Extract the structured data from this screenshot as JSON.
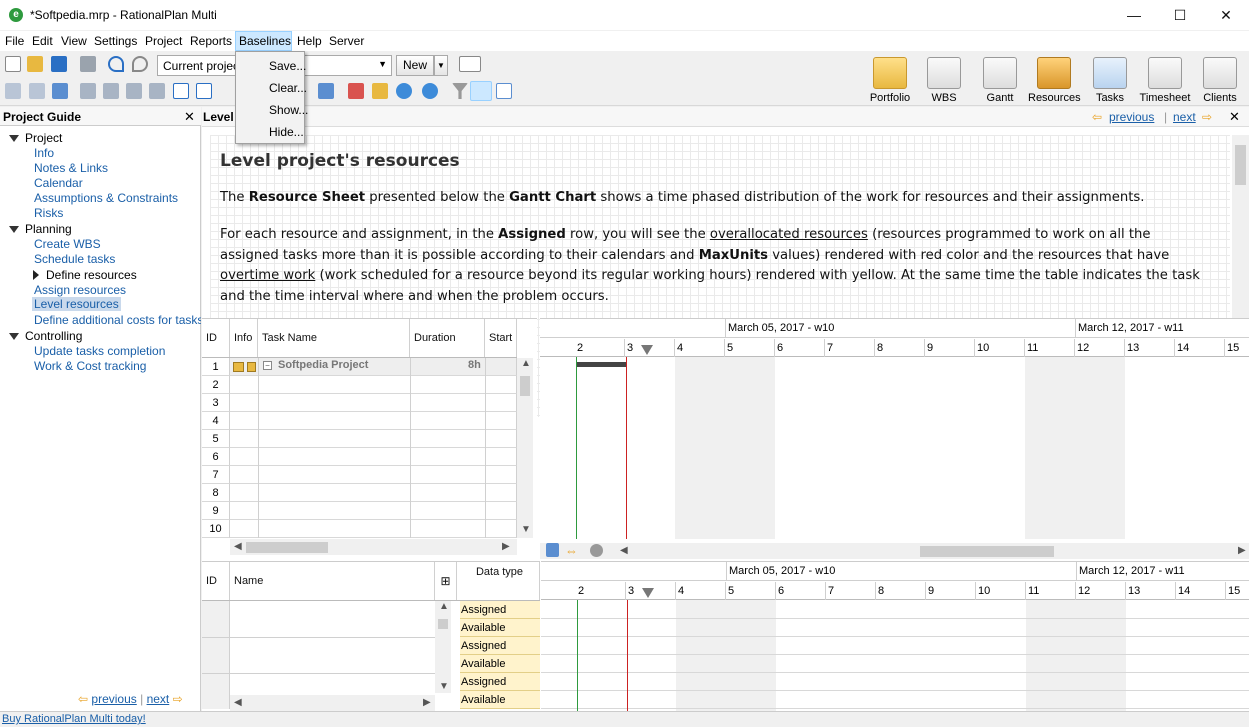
{
  "window": {
    "title": "*Softpedia.mrp - RationalPlan Multi",
    "app_icon": "rationalplan-logo-icon",
    "controls": {
      "minimize": "—",
      "maximize": "☐",
      "close": "✕"
    }
  },
  "menubar": {
    "items": [
      "File",
      "Edit",
      "View",
      "Settings",
      "Project",
      "Reports",
      "Baselines",
      "Help",
      "Server"
    ],
    "active": "Baselines"
  },
  "baselines_menu": {
    "items": [
      "Save...",
      "Clear...",
      "Show...",
      "Hide..."
    ]
  },
  "toolbar": {
    "project_combo_value": "Current project",
    "new_label": "New",
    "big_buttons": [
      "Portfolio",
      "WBS",
      "Gantt",
      "Resources",
      "Tasks",
      "Timesheet",
      "Clients"
    ]
  },
  "guide": {
    "title": "Project Guide",
    "groups": [
      {
        "label": "Project",
        "items": [
          "Info",
          "Notes & Links",
          "Calendar",
          "Assumptions & Constraints",
          "Risks"
        ]
      },
      {
        "label": "Planning",
        "items": [
          "Create WBS",
          "Schedule tasks",
          "Define resources",
          "Assign resources",
          "Level resources",
          "Define additional costs for tasks"
        ]
      },
      {
        "label": "Controlling",
        "items": [
          "Update tasks completion",
          "Work & Cost tracking"
        ]
      }
    ],
    "selected": "Level resources",
    "prev": "previous",
    "next": "next"
  },
  "main": {
    "header_title": "Level",
    "nav_prev": "previous",
    "nav_next": "next",
    "doc": {
      "heading": "Level project's resources",
      "p1_a": "The ",
      "p1_b": "Resource Sheet",
      "p1_c": " presented below the ",
      "p1_d": "Gantt Chart",
      "p1_e": " shows a time phased distribution of the work for resources and their assignments.",
      "p2_a": "For each resource and assignment, in the ",
      "p2_b": "Assigned",
      "p2_c": " row, you will see the ",
      "p2_d": "overallocated resources",
      "p2_e": " (resources programmed to work on all the assigned tasks more than it is possible according to their calendars and ",
      "p2_f": "MaxUnits",
      "p2_g": " values) rendered with red color and the resources that have ",
      "p2_h": "overtime work",
      "p2_i": " (work scheduled for a resource beyond its regular working hours) rendered with yellow. At the same time the table indicates the task and the time interval where and when the problem occurs."
    }
  },
  "task_grid": {
    "headers": {
      "id": "ID",
      "info": "Info",
      "name": "Task Name",
      "duration": "Duration",
      "start": "Start"
    },
    "project_row": {
      "name": "Softpedia Project",
      "duration": "8h"
    },
    "row_ids": [
      "1",
      "2",
      "3",
      "4",
      "5",
      "6",
      "7",
      "8",
      "9",
      "10"
    ]
  },
  "gantt": {
    "weeks": [
      "March 05, 2017 - w10",
      "March 12, 2017 - w11"
    ],
    "days": [
      "2",
      "3",
      "4",
      "5",
      "6",
      "7",
      "8",
      "9",
      "10",
      "11",
      "12",
      "13",
      "14",
      "15"
    ]
  },
  "resource_grid": {
    "headers": {
      "id": "ID",
      "name": "Name",
      "data_type": "Data type"
    },
    "data_types": [
      "Assigned",
      "Available",
      "Assigned",
      "Available",
      "Assigned",
      "Available"
    ]
  },
  "status": {
    "buy_link": "Buy RationalPlan Multi today!"
  },
  "colors": {
    "link": "#1a5fa8",
    "assigned_bg": "#fff3cc",
    "today_line": "#2e9a3e",
    "status_date_line": "#cc2222"
  }
}
